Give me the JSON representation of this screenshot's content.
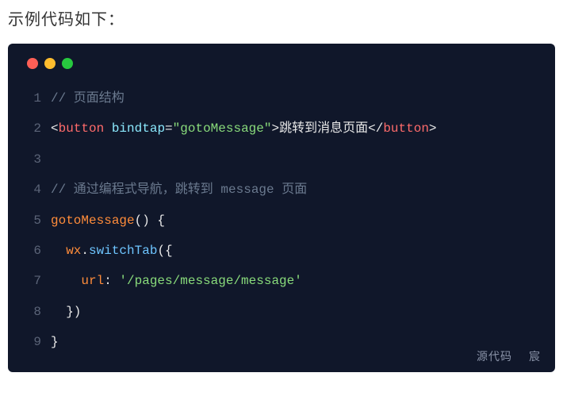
{
  "heading": "示例代码如下：",
  "footer": {
    "left": "源代码",
    "right": "宸"
  },
  "code": {
    "lines": [
      {
        "n": 1,
        "tokens": [
          {
            "cls": "tok-comment",
            "t": "// 页面结构"
          }
        ]
      },
      {
        "n": 2,
        "tokens": [
          {
            "cls": "tok-punct",
            "t": "<"
          },
          {
            "cls": "tok-tag",
            "t": "button"
          },
          {
            "cls": "tok-text",
            "t": " "
          },
          {
            "cls": "tok-attr",
            "t": "bindtap"
          },
          {
            "cls": "tok-punct",
            "t": "="
          },
          {
            "cls": "tok-string",
            "t": "\"gotoMessage\""
          },
          {
            "cls": "tok-punct",
            "t": ">"
          },
          {
            "cls": "tok-text",
            "t": "跳转到消息页面"
          },
          {
            "cls": "tok-punct",
            "t": "</"
          },
          {
            "cls": "tok-tag",
            "t": "button"
          },
          {
            "cls": "tok-punct",
            "t": ">"
          }
        ]
      },
      {
        "n": 3,
        "tokens": []
      },
      {
        "n": 4,
        "tokens": [
          {
            "cls": "tok-comment",
            "t": "// 通过编程式导航，跳转到 message 页面"
          }
        ]
      },
      {
        "n": 5,
        "tokens": [
          {
            "cls": "tok-func",
            "t": "gotoMessage"
          },
          {
            "cls": "tok-text",
            "t": "() {"
          }
        ]
      },
      {
        "n": 6,
        "tokens": [
          {
            "cls": "tok-text",
            "t": "  "
          },
          {
            "cls": "tok-func",
            "t": "wx"
          },
          {
            "cls": "tok-text",
            "t": "."
          },
          {
            "cls": "tok-prop",
            "t": "switchTab"
          },
          {
            "cls": "tok-text",
            "t": "({"
          }
        ]
      },
      {
        "n": 7,
        "tokens": [
          {
            "cls": "tok-text",
            "t": "    "
          },
          {
            "cls": "tok-func",
            "t": "url"
          },
          {
            "cls": "tok-text",
            "t": ": "
          },
          {
            "cls": "tok-string",
            "t": "'/pages/message/message'"
          }
        ]
      },
      {
        "n": 8,
        "tokens": [
          {
            "cls": "tok-text",
            "t": "  })"
          }
        ]
      },
      {
        "n": 9,
        "tokens": [
          {
            "cls": "tok-text",
            "t": "}"
          }
        ]
      }
    ]
  }
}
